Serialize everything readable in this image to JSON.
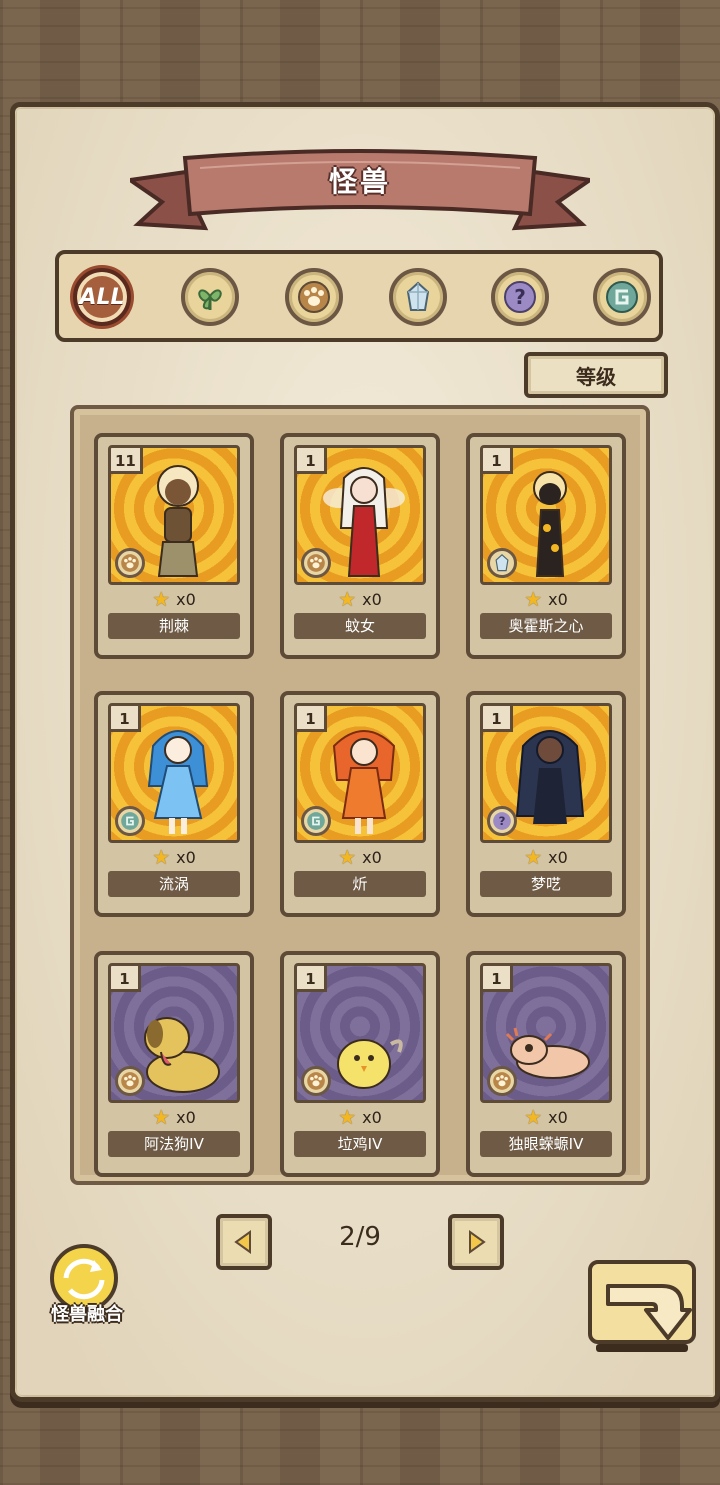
{
  "title": "怪兽",
  "filters": [
    {
      "label": "ALL",
      "icon": "all-icon",
      "active": true
    },
    {
      "icon": "leaf-icon",
      "active": false
    },
    {
      "icon": "paw-icon",
      "active": false
    },
    {
      "icon": "crystal-icon",
      "active": false
    },
    {
      "icon": "question-icon",
      "active": false
    },
    {
      "icon": "swirl-icon",
      "active": false
    }
  ],
  "sort_label": "等级",
  "cards": [
    {
      "level": "11",
      "count": "x0",
      "name": "荆棘",
      "bg": "gold",
      "type": "paw-icon"
    },
    {
      "level": "1",
      "count": "x0",
      "name": "蚊女",
      "bg": "gold",
      "type": "paw-icon"
    },
    {
      "level": "1",
      "count": "x0",
      "name": "奥霍斯之心",
      "bg": "gold",
      "type": "crystal-icon"
    },
    {
      "level": "1",
      "count": "x0",
      "name": "流涡",
      "bg": "gold",
      "type": "swirl-icon"
    },
    {
      "level": "1",
      "count": "x0",
      "name": "炘",
      "bg": "gold",
      "type": "swirl-icon"
    },
    {
      "level": "1",
      "count": "x0",
      "name": "梦呓",
      "bg": "gold",
      "type": "question-icon"
    },
    {
      "level": "1",
      "count": "x0",
      "name": "阿法狗IV",
      "bg": "purple",
      "type": "paw-icon"
    },
    {
      "level": "1",
      "count": "x0",
      "name": "垃鸡IV",
      "bg": "purple",
      "type": "paw-icon"
    },
    {
      "level": "1",
      "count": "x0",
      "name": "独眼蝾螈IV",
      "bg": "purple",
      "type": "paw-icon"
    }
  ],
  "pagination": {
    "label": "2/9"
  },
  "fusion_label": "怪兽融合",
  "colors": {
    "accent": "#a65f3c",
    "gold": "#f6c23a",
    "purple": "#7e6f9b"
  }
}
